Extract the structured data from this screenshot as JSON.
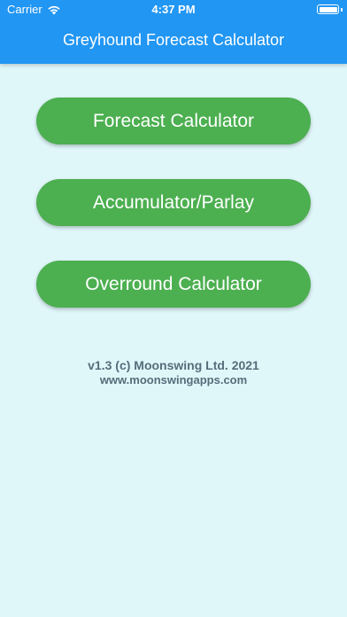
{
  "status_bar": {
    "carrier": "Carrier",
    "time": "4:37 PM",
    "icons": [
      "wifi-icon",
      "battery-icon"
    ]
  },
  "header": {
    "title": "Greyhound Forecast Calculator",
    "background_color": "#2196f3"
  },
  "menu": {
    "buttons": [
      {
        "label": "Forecast Calculator"
      },
      {
        "label": "Accumulator/Parlay"
      },
      {
        "label": "Overround Calculator"
      }
    ],
    "button_color": "#4caf50"
  },
  "footer": {
    "copyright": "v1.3 (c) Moonswing Ltd. 2021",
    "website": "www.moonswingapps.com"
  },
  "colors": {
    "page_background": "#e0f7fa",
    "footer_text": "#546e7a"
  }
}
